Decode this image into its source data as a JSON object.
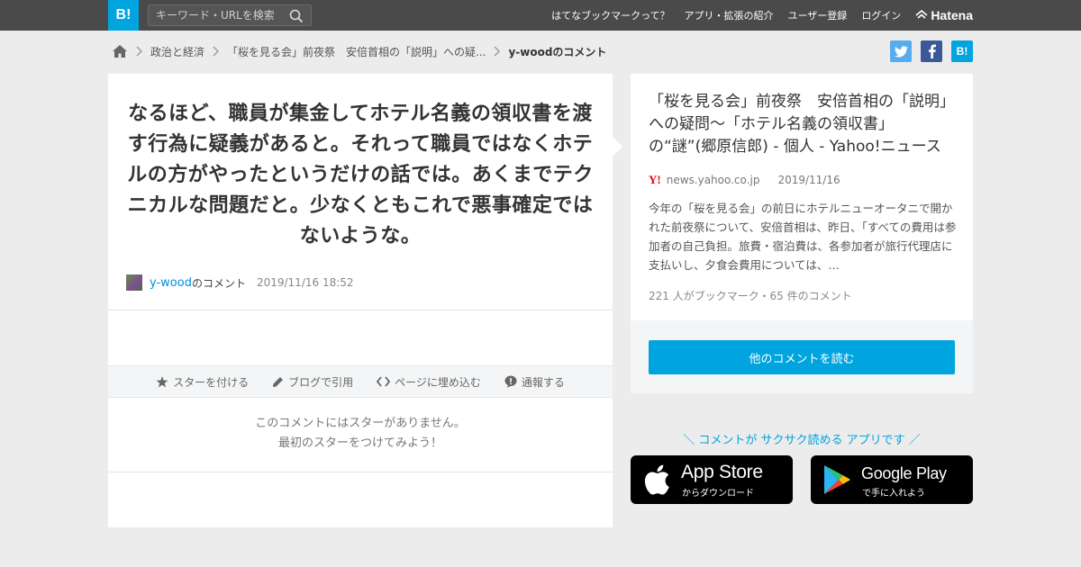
{
  "header": {
    "logo": "B!",
    "search_placeholder": "キーワード・URLを検索",
    "nav": [
      "はてなブックマークって？",
      "アプリ・拡張の紹介",
      "ユーザー登録",
      "ログイン"
    ],
    "brand": "Hatena"
  },
  "breadcrumb": {
    "items": [
      "政治と経済",
      "「桜を見る会」前夜祭　安倍首相の「説明」への疑...",
      "y-woodのコメント"
    ]
  },
  "share": {
    "hatena_label": "B!"
  },
  "comment": {
    "text": "なるほど、職員が集金してホテル名義の領収書を渡す行為に疑義があると。それって職員ではなくホテルの方がやったというだけの話では。あくまでテクニカルな問題だと。少なくともこれで悪事確定ではないような。",
    "user": "y-wood",
    "user_suffix": "のコメント",
    "date": "2019/11/16 18:52"
  },
  "actions": {
    "star": "スターを付ける",
    "blog": "ブログで引用",
    "embed": "ページに埋め込む",
    "report": "通報する"
  },
  "stars": {
    "line1": "このコメントにはスターがありません。",
    "line2": "最初のスターをつけてみよう！"
  },
  "entry": {
    "title": "「桜を見る会」前夜祭　安倍首相の「説明」への疑問～「ホテル名義の領収書」の“謎”(郷原信郎) - 個人 - Yahoo!ニュース",
    "domain": "news.yahoo.co.jp",
    "date": "2019/11/16",
    "summary": "今年の「桜を見る会」の前日にホテルニューオータニで開かれた前夜祭について、安倍首相は、昨日、「すべての費用は参加者の自己負担。旅費・宿泊費は、各参加者が旅行代理店に支払いし、夕食会費用については、…",
    "counts": "221 人がブックマーク・65 件のコメント",
    "more_button": "他のコメントを読む"
  },
  "app": {
    "promo": "＼ コメントが サクサク読める アプリです ／",
    "apple_big": "App Store",
    "apple_small": "からダウンロード",
    "google_big": "Google Play",
    "google_small": "で手に入れよう"
  },
  "colors": {
    "brand_blue": "#00a4de",
    "topbar": "#4a4a4a",
    "background": "#ececec",
    "twitter": "#55acee",
    "facebook": "#3b5998"
  }
}
